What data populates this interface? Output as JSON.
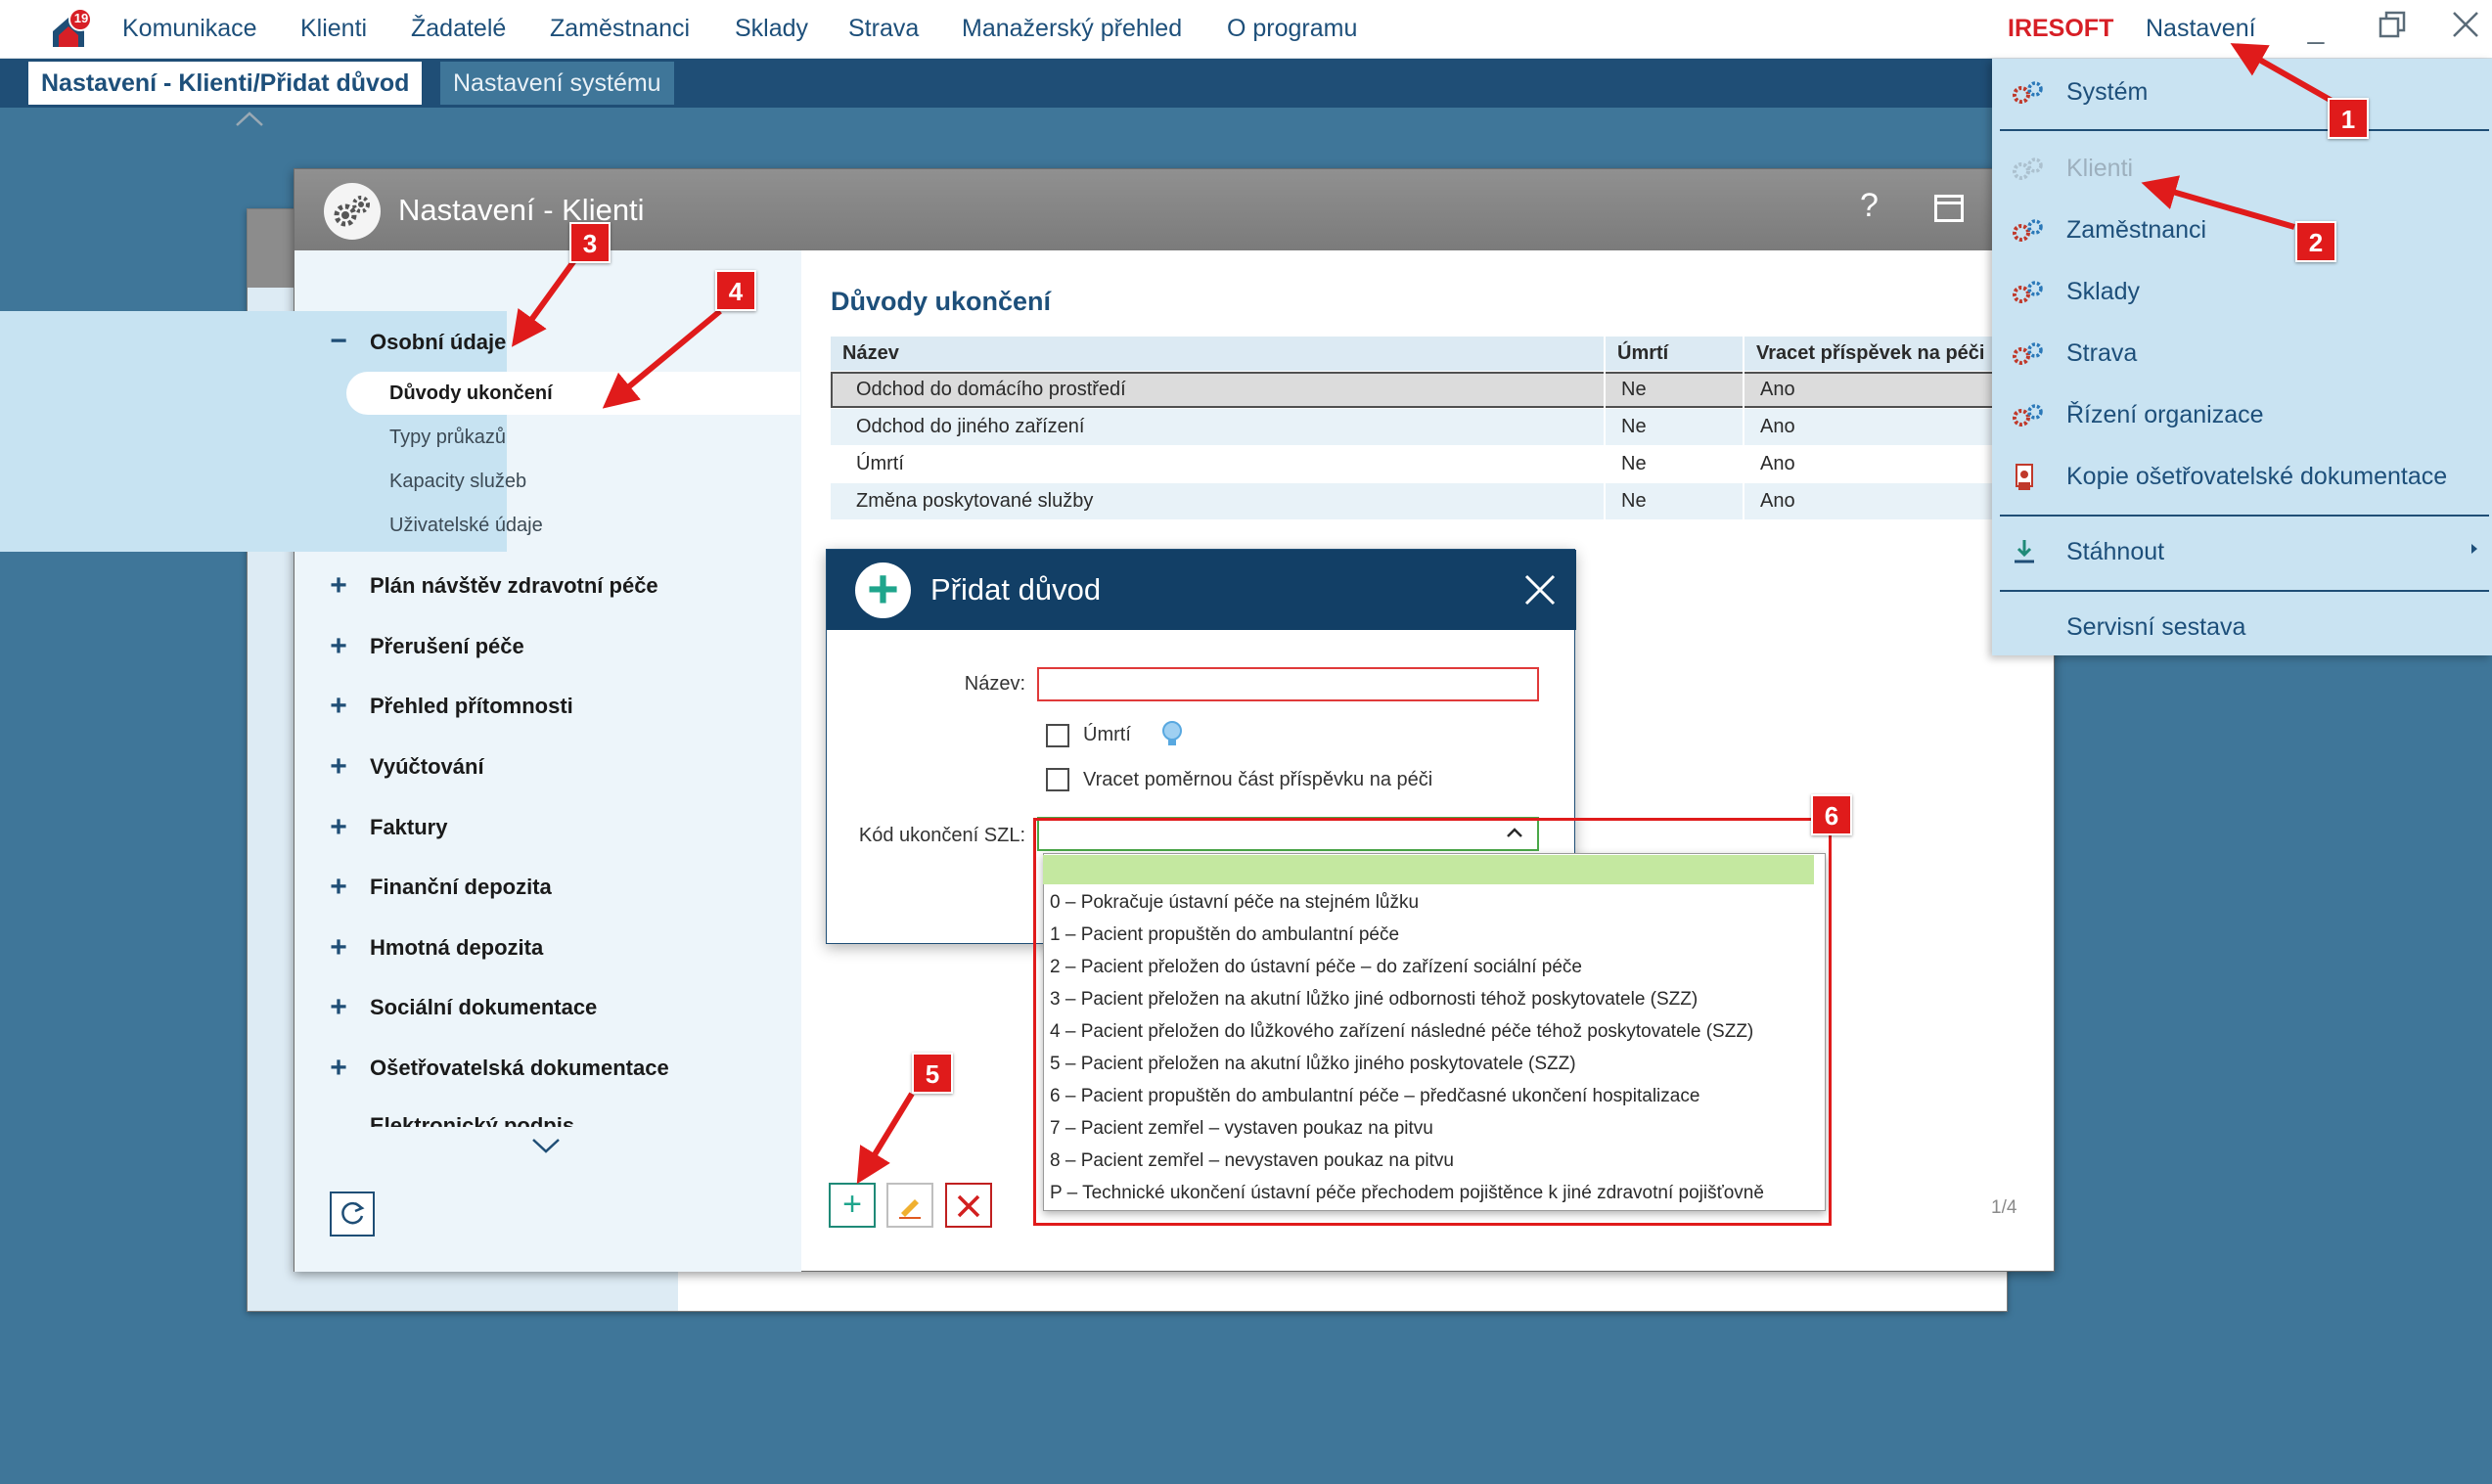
{
  "app": {
    "notification_count": "19",
    "menu": [
      "Komunikace",
      "Klienti",
      "Žadatelé",
      "Zaměstnanci",
      "Sklady",
      "Strava",
      "Manažerský přehled",
      "O programu"
    ],
    "brand": "IRESOFT",
    "settings_label": "Nastavení"
  },
  "tabs": {
    "active": "Nastavení - Klienti/Přidat důvod",
    "system": "Nastavení systému"
  },
  "window": {
    "title": "Nastavení - Klienti",
    "help": "?"
  },
  "sidebar": {
    "active_group": {
      "label": "Osobní údaje",
      "toggle": "−",
      "children": [
        "Důvody ukončení",
        "Typy průkazů",
        "Kapacity služeb",
        "Uživatelské údaje"
      ]
    },
    "groups": [
      "Plán návštěv zdravotní péče",
      "Přerušení péče",
      "Přehled přítomnosti",
      "Vyúčtování",
      "Faktury",
      "Finanční depozita",
      "Hmotná depozita",
      "Sociální dokumentace",
      "Ošetřovatelská dokumentace",
      "Elektronický podpis"
    ],
    "group_toggle": "+"
  },
  "content": {
    "title": "Důvody ukončení",
    "columns": [
      "Název",
      "Úmrtí",
      "Vracet příspěvek na péči"
    ],
    "rows": [
      [
        "Odchod do domácího prostředí",
        "Ne",
        "Ano"
      ],
      [
        "Odchod do jiného zařízení",
        "Ne",
        "Ano"
      ],
      [
        "Úmrtí",
        "Ne",
        "Ano"
      ],
      [
        "Změna poskytované služby",
        "Ne",
        "Ano"
      ]
    ],
    "pager": "1/4"
  },
  "dialog": {
    "title": "Přidat důvod",
    "name_label": "Název:",
    "name_value": "",
    "checkbox_death": "Úmrtí",
    "checkbox_refund": "Vracet poměrnou část příspěvku na péči",
    "code_label": "Kód ukončení SZL:",
    "code_value": "",
    "code_options": [
      "0 – Pokračuje ústavní péče na stejném lůžku",
      "1 – Pacient propuštěn do ambulantní péče",
      "2 – Pacient přeložen do ústavní péče – do zařízení sociální péče",
      "3 – Pacient přeložen na akutní lůžko jiné odbornosti téhož poskytovatele (SZZ)",
      "4 – Pacient přeložen do lůžkového zařízení následné péče téhož poskytovatele (SZZ)",
      "5 – Pacient přeložen na akutní lůžko jiného poskytovatele (SZZ)",
      "6 – Pacient propuštěn do ambulantní péče – předčasné ukončení hospitalizace",
      "7 – Pacient zemřel – vystaven poukaz na pitvu",
      "8 – Pacient zemřel – nevystaven poukaz na pitvu",
      "P – Technické ukončení ústavní péče přechodem pojištěnce k jiné zdravotní pojišťovně"
    ]
  },
  "settings_menu": {
    "items": [
      "Systém",
      "Klienti",
      "Zaměstnanci",
      "Sklady",
      "Strava",
      "Řízení organizace",
      "Kopie ošetřovatelské dokumentace",
      "Stáhnout",
      "Servisní sestava"
    ]
  },
  "annotations": [
    "1",
    "2",
    "3",
    "4",
    "5",
    "6"
  ],
  "colors": {
    "accent": "#1d4f7a",
    "background": "#3f7699",
    "brand": "#d71f26",
    "highlight": "#e01b1b",
    "selection": "#c4e8a0"
  }
}
